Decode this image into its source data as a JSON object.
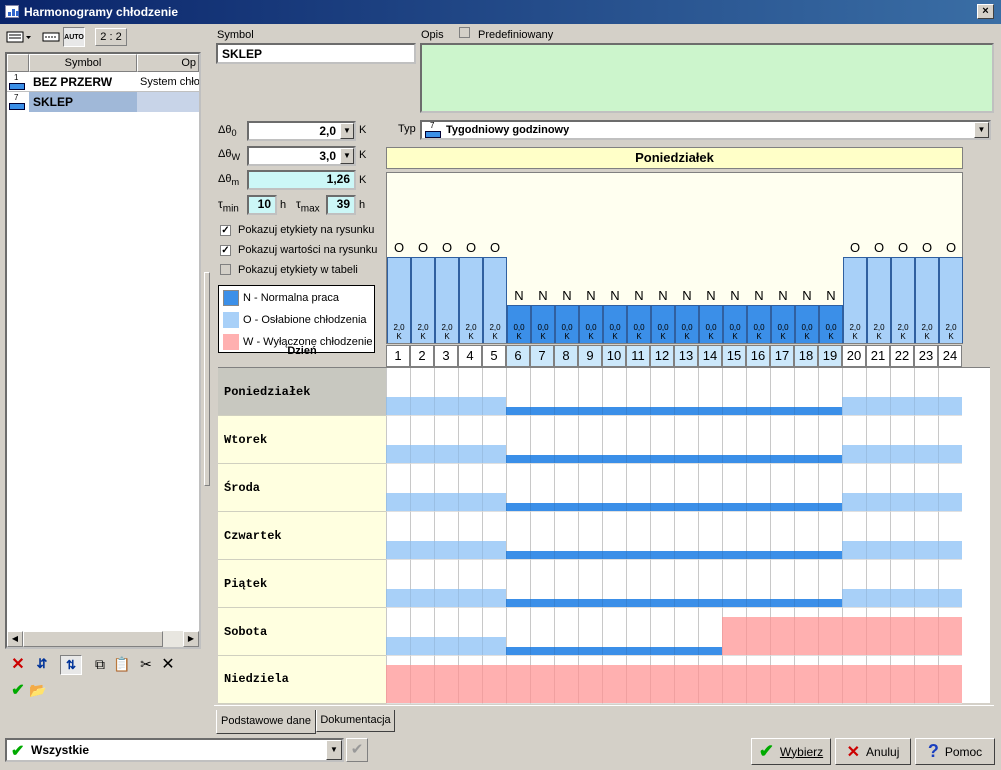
{
  "window": {
    "title": "Harmonogramy chłodzenie",
    "close": "×"
  },
  "toolbar": {
    "ratio": "2 : 2",
    "auto": "AUTO"
  },
  "list": {
    "headers": {
      "symbol": "Symbol",
      "opis": "Op"
    },
    "items": [
      {
        "num": "1",
        "symbol": "BEZ PRZERW",
        "opis": "System chło"
      },
      {
        "num": "7",
        "symbol": "SKLEP",
        "opis": ""
      }
    ]
  },
  "form": {
    "symbol_label": "Symbol",
    "symbol_value": "SKLEP",
    "opis_label": "Opis",
    "predef_label": "Predefiniowany",
    "d0_label": "Δθ",
    "d0_sub": "0",
    "d0_value": "2,0",
    "d0_unit": "K",
    "dw_label": "Δθ",
    "dw_sub": "W",
    "dw_value": "3,0",
    "dw_unit": "K",
    "dm_label": "Δθ",
    "dm_sub": "m",
    "dm_value": "1,26",
    "dm_unit": "K",
    "tmin_label": "τ",
    "tmin_sub": "min",
    "tmin_value": "10",
    "tmin_unit": "h",
    "tmax_label": "τ",
    "tmax_sub": "max",
    "tmax_value": "39",
    "tmax_unit": "h",
    "cb1": "Pokazuj etykiety na rysunku",
    "cb2": "Pokazuj wartości na rysunku",
    "cb3": "Pokazuj etykiety w tabeli",
    "typ_label": "Typ",
    "typ_num": "7",
    "typ_value": "Tygodniowy godzinowy"
  },
  "legend": [
    {
      "text": "N - Normalna praca",
      "color": "#3b8fe8"
    },
    {
      "text": "O - Osłabione chłodzenia",
      "color": "#a8d0f8"
    },
    {
      "text": "W - Wyłączone chłodzenie",
      "color": "#ffb0b0"
    }
  ],
  "chart": {
    "day_title": "Poniedziałek",
    "dzien_label": "Dzień",
    "hours": [
      "1",
      "2",
      "3",
      "4",
      "5",
      "6",
      "7",
      "8",
      "9",
      "10",
      "11",
      "12",
      "13",
      "14",
      "15",
      "16",
      "17",
      "18",
      "19",
      "20",
      "21",
      "22",
      "23",
      "24"
    ],
    "monday_modes": [
      "O",
      "O",
      "O",
      "O",
      "O",
      "N",
      "N",
      "N",
      "N",
      "N",
      "N",
      "N",
      "N",
      "N",
      "N",
      "N",
      "N",
      "N",
      "N",
      "O",
      "O",
      "O",
      "O",
      "O"
    ],
    "monday_values": [
      "2,0",
      "2,0",
      "2,0",
      "2,0",
      "2,0",
      "0,0",
      "0,0",
      "0,0",
      "0,0",
      "0,0",
      "0,0",
      "0,0",
      "0,0",
      "0,0",
      "0,0",
      "0,0",
      "0,0",
      "0,0",
      "0,0",
      "2,0",
      "2,0",
      "2,0",
      "2,0",
      "2,0"
    ],
    "unit": "K"
  },
  "days": [
    {
      "name": "Poniedziałek",
      "modes": "OOOOONNNNNNNNNNNNNNOOOOO"
    },
    {
      "name": "Wtorek",
      "modes": "OOOOONNNNNNNNNNNNNNOOOOO"
    },
    {
      "name": "Środa",
      "modes": "OOOOONNNNNNNNNNNNNNOOOOO"
    },
    {
      "name": "Czwartek",
      "modes": "OOOOONNNNNNNNNNNNNNOOOOO"
    },
    {
      "name": "Piątek",
      "modes": "OOOOONNNNNNNNNNNNNNOOOOO"
    },
    {
      "name": "Sobota",
      "modes": "OOOOONNNNNNNNNWWWWWWWWWW"
    },
    {
      "name": "Niedziela",
      "modes": "WWWWWWWWWWWWWWWWWWWWWWWW"
    }
  ],
  "tabs": [
    "Podstawowe dane",
    "Dokumentacja"
  ],
  "filter": {
    "value": "Wszystkie"
  },
  "buttons": {
    "select": "Wybierz",
    "cancel": "Anuluj",
    "help": "Pomoc"
  },
  "colors": {
    "N": "#3b8fe8",
    "O": "#a8d0f8",
    "W": "#ffb0b0",
    "chartbg": "#fffff0",
    "daybg": "#ffffe0",
    "greenbox": "#ccf5cc",
    "cyan": "#ccf7f7"
  }
}
